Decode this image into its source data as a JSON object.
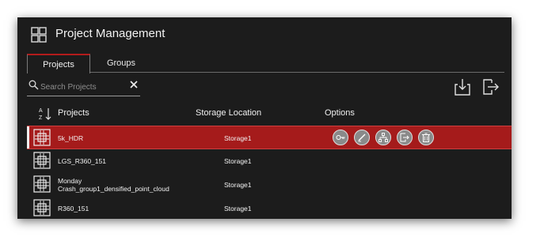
{
  "app": {
    "title": "Project Management",
    "icon": "grid-icon"
  },
  "tabs": [
    {
      "label": "Projects",
      "active": true
    },
    {
      "label": "Groups",
      "active": false
    }
  ],
  "search": {
    "placeholder": "Search Projects",
    "value": ""
  },
  "toolbar": {
    "export_icon": "download-icon",
    "logout_icon": "logout-icon"
  },
  "table": {
    "columns": [
      "Projects",
      "Storage Location",
      "Options"
    ],
    "sort_icon": "sort-az-icon",
    "rows": [
      {
        "name": "5k_HDR",
        "storage": "Storage1",
        "selected": true
      },
      {
        "name": "LGS_R360_151",
        "storage": "Storage1",
        "selected": false
      },
      {
        "name": "Monday Crash_group1_densified_point_cloud",
        "name_line1": "Monday",
        "name_line2": "Crash_group1_densified_point_cloud",
        "storage": "Storage1",
        "selected": false
      },
      {
        "name": "R360_151",
        "storage": "Storage1",
        "selected": false
      }
    ],
    "options": [
      "key-icon",
      "edit-icon",
      "hierarchy-icon",
      "export-icon",
      "trash-icon"
    ]
  },
  "colors": {
    "accent": "#a51b1b",
    "background": "#1c1c1c",
    "text": "#f2f2f2"
  }
}
